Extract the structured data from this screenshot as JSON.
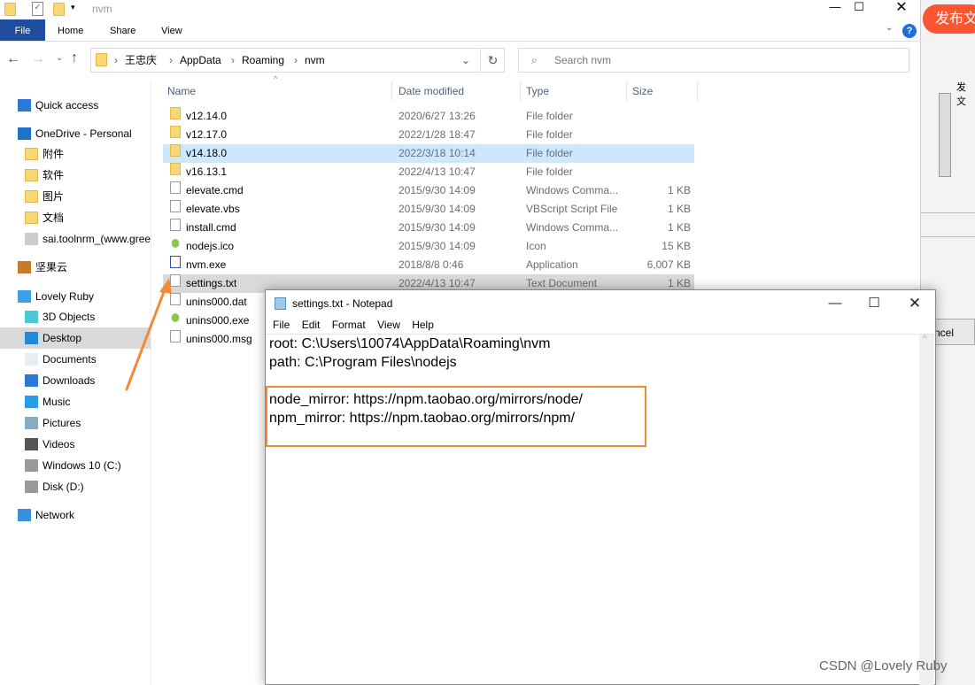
{
  "background_app": {
    "publish_button": "发布文",
    "watermark": "CSDN @Lovely Ruby"
  },
  "explorer": {
    "title": "nvm",
    "ribbon_tabs": [
      "File",
      "Home",
      "Share",
      "View"
    ],
    "breadcrumb": [
      "王忠庆",
      "AppData",
      "Roaming",
      "nvm"
    ],
    "search_placeholder": "Search nvm",
    "nav": [
      {
        "label": "Quick access",
        "icon": "star-icon"
      },
      {
        "label": "OneDrive - Personal",
        "icon": "cloud-icon"
      },
      {
        "label": "附件",
        "icon": "folder-icon"
      },
      {
        "label": "软件",
        "icon": "folder-icon"
      },
      {
        "label": "图片",
        "icon": "folder-icon"
      },
      {
        "label": "文档",
        "icon": "folder-icon"
      },
      {
        "label": "sai.toolnrm_(www.gree",
        "icon": "file-icon"
      },
      {
        "label": "坚果云",
        "icon": "nut-icon"
      },
      {
        "label": "Lovely Ruby",
        "icon": "computer-icon"
      },
      {
        "label": "3D Objects",
        "icon": "cube-icon"
      },
      {
        "label": "Desktop",
        "icon": "desktop-icon",
        "selected": true
      },
      {
        "label": "Documents",
        "icon": "documents-icon"
      },
      {
        "label": "Downloads",
        "icon": "download-icon"
      },
      {
        "label": "Music",
        "icon": "music-icon"
      },
      {
        "label": "Pictures",
        "icon": "pictures-icon"
      },
      {
        "label": "Videos",
        "icon": "videos-icon"
      },
      {
        "label": "Windows 10 (C:)",
        "icon": "drive-icon"
      },
      {
        "label": "Disk (D:)",
        "icon": "drive-icon"
      },
      {
        "label": "Network",
        "icon": "network-icon"
      }
    ],
    "columns": [
      "Name",
      "Date modified",
      "Type",
      "Size"
    ],
    "files": [
      {
        "name": "v12.14.0",
        "date": "2020/6/27 13:26",
        "type": "File folder",
        "size": "",
        "icon": "folder-icon"
      },
      {
        "name": "v12.17.0",
        "date": "2022/1/28 18:47",
        "type": "File folder",
        "size": "",
        "icon": "folder-icon"
      },
      {
        "name": "v14.18.0",
        "date": "2022/3/18 10:14",
        "type": "File folder",
        "size": "",
        "icon": "folder-icon",
        "hover": true
      },
      {
        "name": "v16.13.1",
        "date": "2022/4/13 10:47",
        "type": "File folder",
        "size": "",
        "icon": "folder-icon"
      },
      {
        "name": "elevate.cmd",
        "date": "2015/9/30 14:09",
        "type": "Windows Comma...",
        "size": "1 KB",
        "icon": "cmd-icon"
      },
      {
        "name": "elevate.vbs",
        "date": "2015/9/30 14:09",
        "type": "VBScript Script File",
        "size": "1 KB",
        "icon": "script-icon"
      },
      {
        "name": "install.cmd",
        "date": "2015/9/30 14:09",
        "type": "Windows Comma...",
        "size": "1 KB",
        "icon": "cmd-icon"
      },
      {
        "name": "nodejs.ico",
        "date": "2015/9/30 14:09",
        "type": "Icon",
        "size": "15 KB",
        "icon": "nodejs-icon"
      },
      {
        "name": "nvm.exe",
        "date": "2018/8/8 0:46",
        "type": "Application",
        "size": "6,007 KB",
        "icon": "exe-icon"
      },
      {
        "name": "settings.txt",
        "date": "2022/4/13 10:47",
        "type": "Text Document",
        "size": "1 KB",
        "icon": "text-file-icon",
        "selected": true
      },
      {
        "name": "unins000.dat",
        "date": "",
        "type": "",
        "size": "",
        "icon": "file-icon"
      },
      {
        "name": "unins000.exe",
        "date": "",
        "type": "",
        "size": "",
        "icon": "nodejs-icon"
      },
      {
        "name": "unins000.msg",
        "date": "",
        "type": "",
        "size": "",
        "icon": "file-icon"
      }
    ]
  },
  "notepad": {
    "title": "settings.txt - Notepad",
    "menu": [
      "File",
      "Edit",
      "Format",
      "View",
      "Help"
    ],
    "content": "root: C:\\Users\\10074\\AppData\\Roaming\\nvm\npath: C:\\Program Files\\nodejs\n\nnode_mirror: https://npm.taobao.org/mirrors/node/\nnpm_mirror: https://npm.taobao.org/mirrors/npm/"
  },
  "colors": {
    "accent": "#1f4e9e",
    "annotation": "#f08a36",
    "csdn": "#fc5531"
  }
}
